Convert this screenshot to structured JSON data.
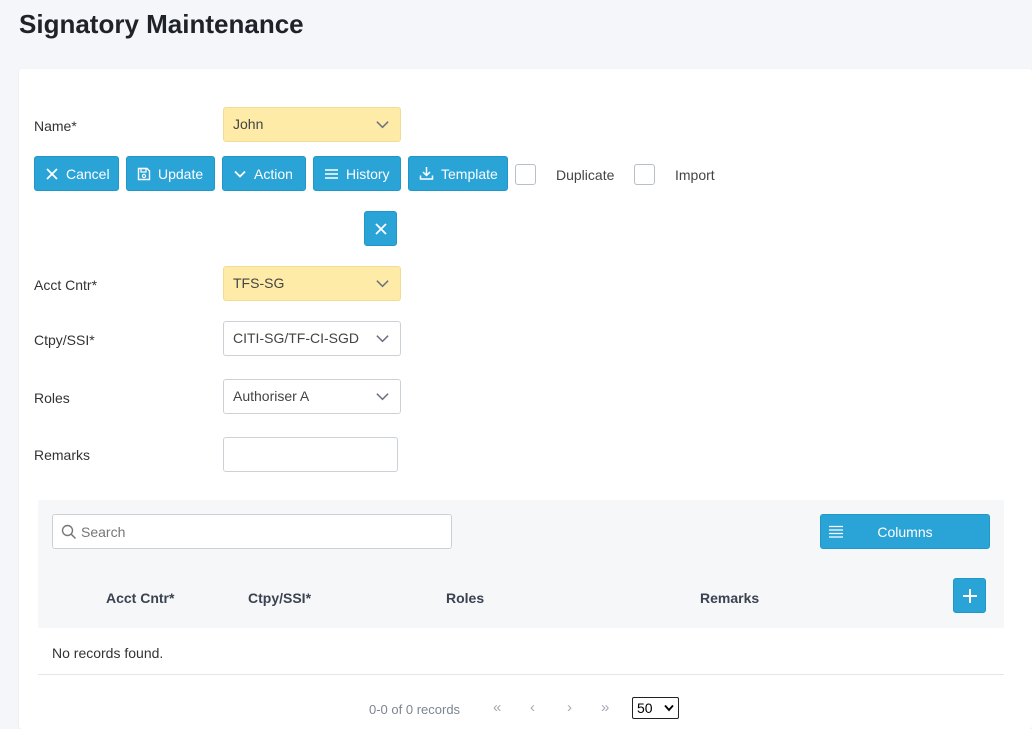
{
  "page": {
    "title": "Signatory Maintenance"
  },
  "form": {
    "name": {
      "label": "Name*",
      "value": "John"
    },
    "acct_cntr": {
      "label": "Acct Cntr*",
      "value": "TFS-SG"
    },
    "ctpy_ssi": {
      "label": "Ctpy/SSI*",
      "value": "CITI-SG/TF-CI-SGD"
    },
    "roles": {
      "label": "Roles",
      "value": "Authoriser A"
    },
    "remarks": {
      "label": "Remarks",
      "value": ""
    }
  },
  "toolbar": {
    "cancel": "Cancel",
    "update": "Update",
    "action": "Action",
    "history": "History",
    "template": "Template",
    "duplicate": "Duplicate",
    "import": "Import"
  },
  "table": {
    "search_placeholder": "Search",
    "columns_label": "Columns",
    "headers": [
      "Acct Cntr*",
      "Ctpy/SSI*",
      "Roles",
      "Remarks"
    ],
    "empty_message": "No records found.",
    "pager_text": "0-0 of 0 records",
    "page_size": "50"
  },
  "colors": {
    "accent": "#2aa3d7",
    "required_field": "#fdeba7"
  },
  "icons": [
    "close-icon",
    "save-icon",
    "chevron-down-icon",
    "menu-icon",
    "download-icon",
    "search-icon",
    "plus-icon",
    "first-page-icon",
    "prev-page-icon",
    "next-page-icon",
    "last-page-icon"
  ]
}
